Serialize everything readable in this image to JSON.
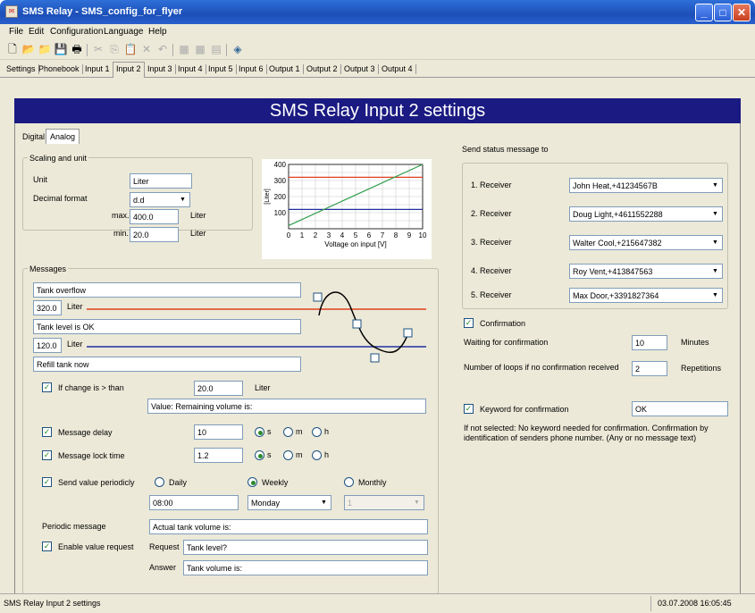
{
  "window": {
    "title": "SMS Relay - SMS_config_for_flyer"
  },
  "menu": [
    "File",
    "Edit",
    "Configuration",
    "Language",
    "Help"
  ],
  "tabs": [
    "Settings",
    "Phonebook",
    "Input 1",
    "Input 2",
    "Input 3",
    "Input 4",
    "Input 5",
    "Input 6",
    "Output 1",
    "Output 2",
    "Output 3",
    "Output 4"
  ],
  "header": "SMS Relay Input 2 settings",
  "subtabs": {
    "digital": "Digital",
    "analog": "Analog"
  },
  "scaling": {
    "group": "Scaling and unit",
    "unit_label": "Unit",
    "unit_value": "Liter",
    "format_label": "Decimal format",
    "format_value": "d.d",
    "max_label": "max.",
    "max_value": "400.0",
    "min_label": "min.",
    "min_value": "20.0",
    "unit_suffix": "Liter"
  },
  "chart_data": {
    "type": "line",
    "ylabel": "[Liter]",
    "xlabel": "Voltage on input [V]",
    "xlim": [
      0,
      10
    ],
    "ylim": [
      0,
      400
    ],
    "xticks": [
      "0",
      "1",
      "2",
      "3",
      "4",
      "5",
      "6",
      "7",
      "8",
      "9",
      "10"
    ],
    "yticks": [
      "100",
      "200",
      "300",
      "400"
    ],
    "series": [
      {
        "x": [
          0,
          10
        ],
        "y": [
          20,
          400
        ],
        "color": "#2f9d4a"
      }
    ],
    "hlines": [
      {
        "y": 320,
        "color": "#e04020"
      },
      {
        "y": 120,
        "color": "#2030a0"
      }
    ]
  },
  "messages": {
    "group": "Messages",
    "msg_overflow": "Tank overflow",
    "level_high": "320.0",
    "level_unit": "Liter",
    "msg_ok": "Tank level is OK",
    "level_low": "120.0",
    "msg_refill": "Refill tank now",
    "change_label": "If change is > than",
    "change_value": "20.0",
    "change_unit": "Liter",
    "value_text": "Value: Remaining volume is:",
    "delay_label": "Message delay",
    "delay_value": "10",
    "lock_label": "Message lock time",
    "lock_value": "1.2",
    "s": "s",
    "m": "m",
    "h": "h",
    "periodic_label": "Send value periodicly",
    "daily": "Daily",
    "weekly": "Weekly",
    "monthly": "Monthly",
    "time_value": "08:00",
    "day_value": "Monday",
    "month_value": "1",
    "periodic_msg_label": "Periodic message",
    "periodic_msg_value": "Actual tank volume is:",
    "request_enable": "Enable value request",
    "request_label": "Request",
    "request_value": "Tank level?",
    "answer_label": "Answer",
    "answer_value": "Tank volume is:"
  },
  "receivers": {
    "title": "Send status message to",
    "items": [
      {
        "label": "1. Receiver",
        "value": "John Heat,+41234567B"
      },
      {
        "label": "2. Receiver",
        "value": "Doug Light,+4611552288"
      },
      {
        "label": "3. Receiver",
        "value": "Walter Cool,+215647382"
      },
      {
        "label": "4. Receiver",
        "value": "Roy Vent,+413847563"
      },
      {
        "label": "5. Receiver",
        "value": "Max Door,+3391827364"
      }
    ]
  },
  "confirmation": {
    "label": "Confirmation",
    "wait_label": "Waiting for confirmation",
    "wait_value": "10",
    "wait_unit": "Minutes",
    "loops_label": "Number of loops if no confirmation received",
    "loops_value": "2",
    "loops_unit": "Repetitions",
    "keyword_label": "Keyword for confirmation",
    "keyword_value": "OK",
    "note": "If not selected: No keyword needed for confirmation. Confirmation by identification of senders phone number. (Any or no message text)"
  },
  "status": {
    "left": "SMS Relay Input 2 settings",
    "right": "03.07.2008 16:05:45"
  }
}
